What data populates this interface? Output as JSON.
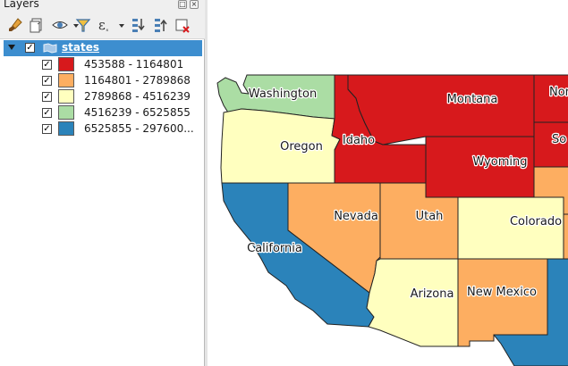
{
  "panel": {
    "title": "Layers"
  },
  "toolbar": {
    "items": [
      "style-brush-icon",
      "add-group-icon",
      "visibility-eye-icon",
      "filter-icon",
      "expression-filter-icon",
      "expand-all-icon",
      "collapse-all-icon",
      "remove-layer-icon"
    ]
  },
  "layer": {
    "name": "states",
    "checked": true,
    "expanded": true,
    "legend": [
      {
        "label": "453588 - 1164801",
        "color": "#d7191c",
        "checked": true
      },
      {
        "label": "1164801 - 2789868",
        "color": "#fdae61",
        "checked": true
      },
      {
        "label": "2789868 - 4516239",
        "color": "#ffffbf",
        "checked": true
      },
      {
        "label": "4516239 - 6525855",
        "color": "#abdda4",
        "checked": true
      },
      {
        "label": "6525855 - 297600...",
        "color": "#2b83ba",
        "checked": true
      }
    ]
  },
  "map": {
    "states": [
      {
        "name": "Washington",
        "color": "#abdda4"
      },
      {
        "name": "Oregon",
        "color": "#ffffbf"
      },
      {
        "name": "Idaho",
        "color": "#d7191c"
      },
      {
        "name": "Montana",
        "color": "#d7191c"
      },
      {
        "name": "Wyoming",
        "color": "#d7191c"
      },
      {
        "name": "Nevada",
        "color": "#fdae61"
      },
      {
        "name": "Utah",
        "color": "#fdae61"
      },
      {
        "name": "Colorado",
        "color": "#ffffbf"
      },
      {
        "name": "California",
        "color": "#2b83ba"
      },
      {
        "name": "Arizona",
        "color": "#ffffbf"
      },
      {
        "name": "New Mexico",
        "color": "#fdae61"
      },
      {
        "name": "Nor",
        "color": "#d7191c"
      },
      {
        "name": "So",
        "color": "#d7191c"
      }
    ]
  }
}
